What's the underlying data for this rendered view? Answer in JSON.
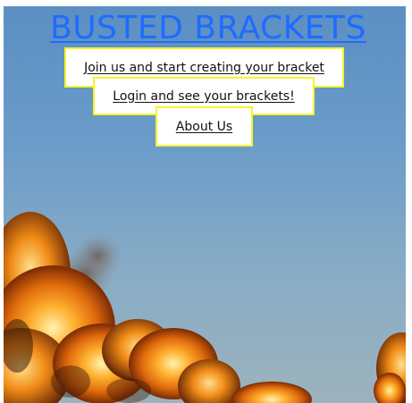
{
  "header": {
    "title": "BUSTED BRACKETS"
  },
  "nav": {
    "signup_label": "Join us and start creating your bracket",
    "login_label": "Login and see your brackets!",
    "about_label": "About Us"
  },
  "colors": {
    "title_link": "#1f6bff",
    "button_border": "#f5f52a",
    "button_background": "#ffffff",
    "sky": "#6b9cc9",
    "fire": "#e07a10"
  }
}
